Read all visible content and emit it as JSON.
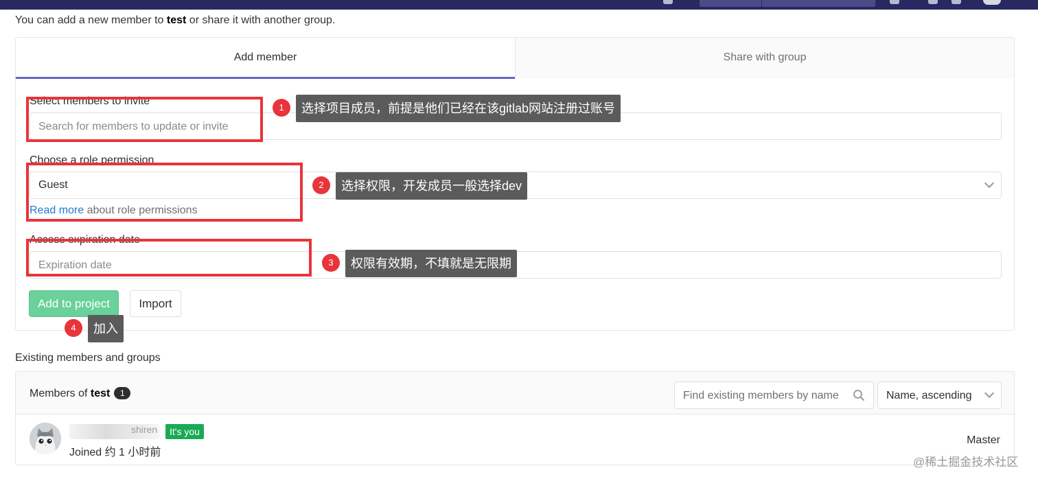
{
  "intro": {
    "prefix": "You can add a new member to ",
    "project": "test",
    "suffix": " or share it with another group."
  },
  "tabs": {
    "add_member": "Add member",
    "share_with_group": "Share with group"
  },
  "form": {
    "select_members_label": "Select members to invite",
    "select_members_placeholder": "Search for members to update or invite",
    "role_label": "Choose a role permission",
    "role_value": "Guest",
    "role_help_link": "Read more",
    "role_help_text": " about role permissions",
    "expiration_label": "Access expiration date",
    "expiration_placeholder": "Expiration date",
    "add_button": "Add to project",
    "import_button": "Import"
  },
  "existing": {
    "title": "Existing members and groups",
    "members_prefix": "Members of ",
    "project": "test",
    "count": "1",
    "find_placeholder": "Find existing members by name",
    "sort_value": "Name, ascending",
    "rows": [
      {
        "name_visible_tail": "shiren",
        "badge": "It's you",
        "joined": "Joined 约 1 小时前",
        "role": "Master"
      }
    ]
  },
  "annotations": [
    {
      "number": "1",
      "text": "选择项目成员，前提是他们已经在该gitlab网站注册过账号"
    },
    {
      "number": "2",
      "text": "选择权限，开发成员一般选择dev"
    },
    {
      "number": "3",
      "text": "权限有效期，不填就是无限期"
    },
    {
      "number": "4",
      "text": "加入"
    }
  ],
  "watermark": "@稀土掘金技术社区",
  "colors": {
    "topbar": "#292961",
    "tab_active_border": "#6666c4",
    "add_button": "#69d199",
    "link": "#1f78d1",
    "badge_you": "#1aaa55",
    "annotation_red": "#e8343a",
    "callout_bg": "#5b5b5b"
  }
}
